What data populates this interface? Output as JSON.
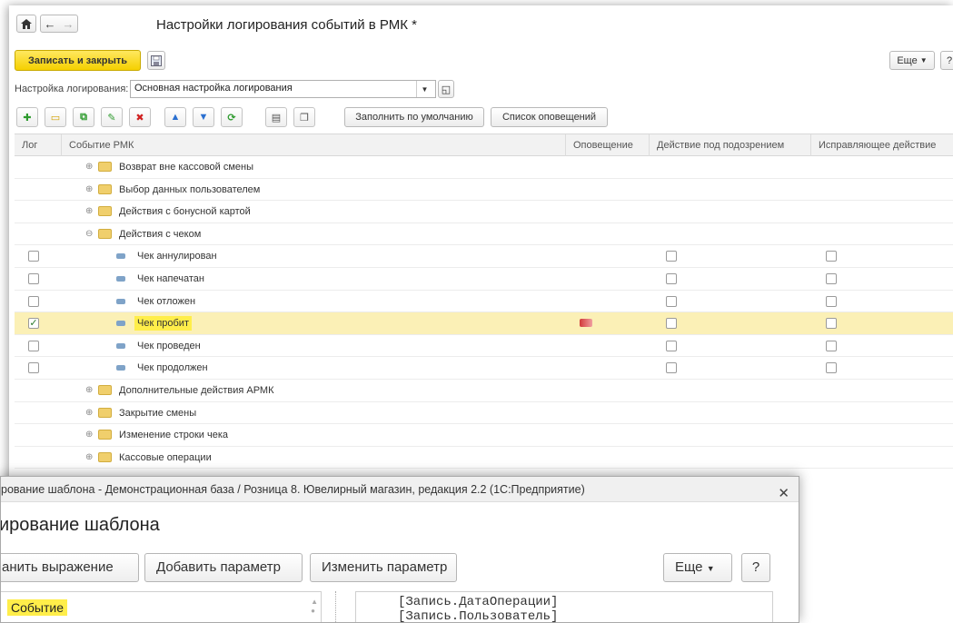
{
  "main": {
    "title": "Настройки логирования событий в РМК *",
    "save_close": "Записать и закрыть",
    "more": "Еще",
    "help": "?",
    "config_label": "Настройка логирования:",
    "config_value": "Основная настройка логирования",
    "fill_default": "Заполнить по умолчанию",
    "notify_list": "Список оповещений"
  },
  "table": {
    "headers": {
      "log": "Лог",
      "event": "Событие РМК",
      "notify": "Оповещение",
      "suspicious": "Действие под подозрением",
      "fix": "Исправляющее действие"
    },
    "rows": [
      {
        "type": "folder",
        "text": "Возврат вне кассовой смены",
        "expanded": false
      },
      {
        "type": "folder",
        "text": "Выбор данных пользователем",
        "expanded": false
      },
      {
        "type": "folder",
        "text": "Действия с бонусной картой",
        "expanded": false
      },
      {
        "type": "folder",
        "text": "Действия с чеком",
        "expanded": true
      },
      {
        "type": "item",
        "text": "Чек аннулирован",
        "log": false
      },
      {
        "type": "item",
        "text": "Чек напечатан",
        "log": false
      },
      {
        "type": "item",
        "text": "Чек отложен",
        "log": false
      },
      {
        "type": "item",
        "text": "Чек пробит",
        "log": true,
        "selected": true
      },
      {
        "type": "item",
        "text": "Чек проведен",
        "log": false
      },
      {
        "type": "item",
        "text": "Чек продолжен",
        "log": false
      },
      {
        "type": "folder",
        "text": "Дополнительные действия АРМК",
        "expanded": false
      },
      {
        "type": "folder",
        "text": "Закрытие смены",
        "expanded": false
      },
      {
        "type": "folder",
        "text": "Изменение строки чека",
        "expanded": false
      },
      {
        "type": "folder",
        "text": "Кассовые операции",
        "expanded": false
      }
    ]
  },
  "dialog": {
    "title": "рование шаблона - Демонстрационная база / Розница 8. Ювелирный магазин, редакция 2.2  (1С:Предприятие)",
    "heading": "ирование шаблона",
    "save_expr": "анить выражение",
    "add_param": "Добавить параметр",
    "edit_param": "Изменить параметр",
    "more": "Еще",
    "help": "?",
    "left_item": "Событие",
    "expr_line1": "[Запись.ДатаОперации]",
    "expr_line2": "[Запись.Пользователь]"
  }
}
